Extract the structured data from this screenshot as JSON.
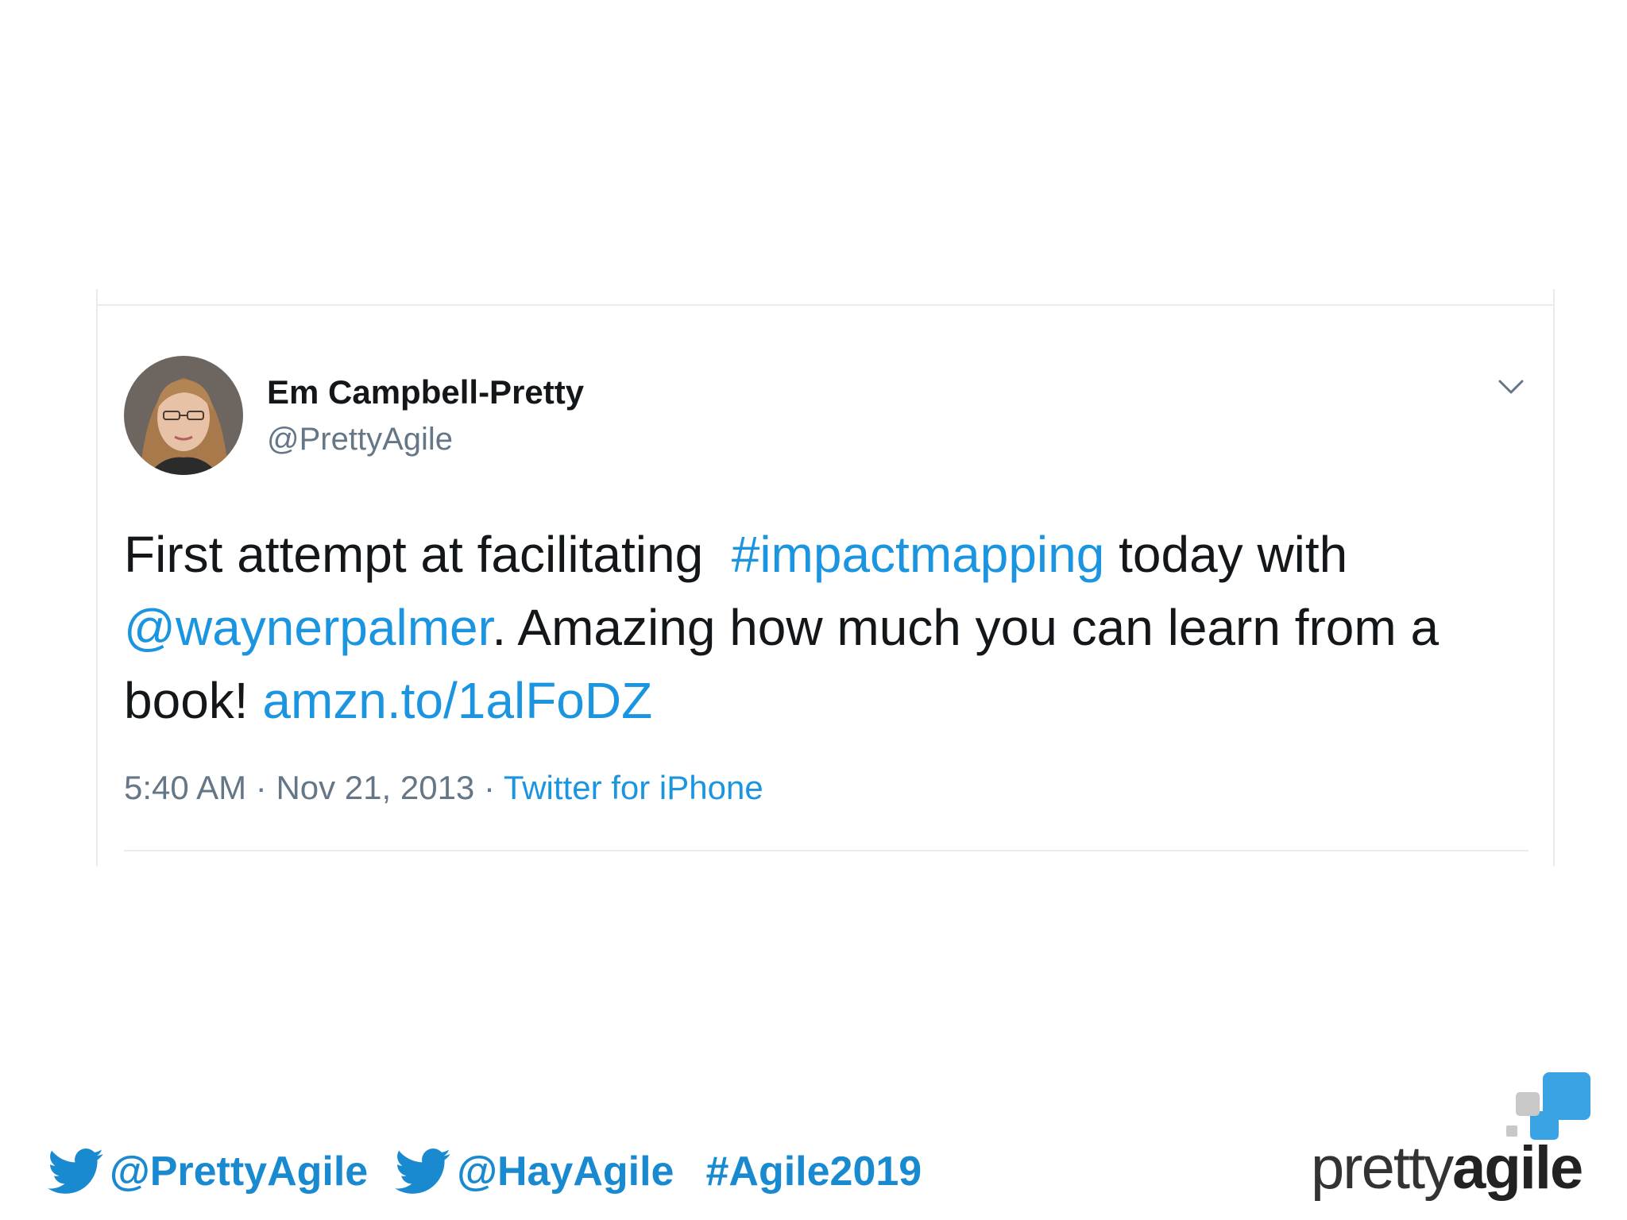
{
  "tweet": {
    "author_name": "Em Campbell-Pretty",
    "author_handle": "@PrettyAgile",
    "text_1": "First attempt at facilitating",
    "hashtag": "#impactmapping",
    "text_2": "today with",
    "mention": "@waynerpalmer",
    "text_3": ". Amazing how much you can learn from a book!",
    "link": "amzn.to/1alFoDZ",
    "time": "5:40 AM",
    "date": "Nov 21, 2013",
    "source": "Twitter for iPhone",
    "separator": " · "
  },
  "footer": {
    "handle_1": "@PrettyAgile",
    "handle_2": "@HayAgile",
    "hashtag": "#Agile2019"
  },
  "logo": {
    "word_1": "pretty",
    "word_2": "agile"
  },
  "colors": {
    "link_blue": "#1b95e0",
    "footer_blue": "#1a8ad0",
    "logo_blue": "#3aa3e3",
    "logo_grey": "#c8c8c8"
  },
  "icons": [
    "chevron-down-icon",
    "twitter-bird-icon",
    "avatar"
  ]
}
